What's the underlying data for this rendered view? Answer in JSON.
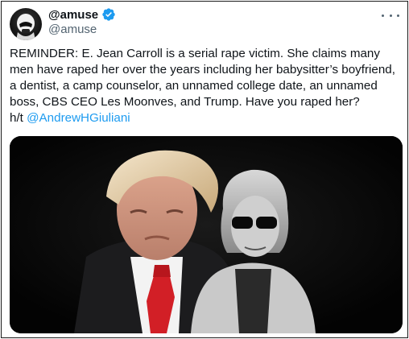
{
  "author": {
    "display_name": "@amuse",
    "handle": "@amuse",
    "verified": true,
    "avatar_icon": "stormtrooper-avatar",
    "verified_color": "#1d9bf0"
  },
  "menu": {
    "icon": "more-horizontal-icon"
  },
  "tweet": {
    "text": "REMINDER: E. Jean Carroll is a serial rape victim. She claims many men have raped her over the years including her babysitter’s boyfriend, a dentist, a camp counselor, an unnamed college date, an unnamed boss, CBS CEO Les Moonves, and Trump. Have you raped her?",
    "hat_tip_prefix": "h/t",
    "mention": "@AndrewHGiuliani",
    "link_color": "#1d9bf0"
  },
  "media": {
    "description_icon": "photo-two-people",
    "background_color": "#050505",
    "tie_color": "#d21f26"
  }
}
